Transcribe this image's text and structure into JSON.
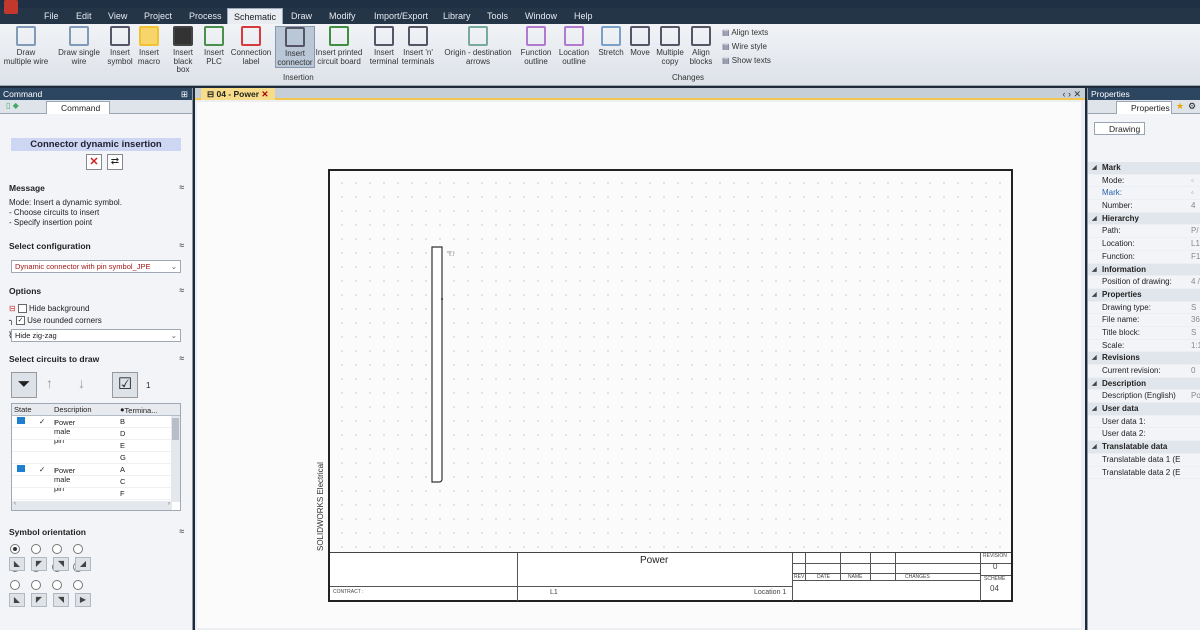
{
  "menu": [
    "File",
    "Edit",
    "View",
    "Project",
    "Process",
    "Schematic",
    "Draw",
    "Modify",
    "Import/Export",
    "Library",
    "Tools",
    "Window",
    "Help"
  ],
  "menu_active": "Schematic",
  "ribbon": {
    "buttons": [
      {
        "label": "Draw multiple wire",
        "icon": "multiple-wire-icon"
      },
      {
        "label": "Draw single wire",
        "icon": "single-wire-icon"
      },
      {
        "label": "Insert symbol",
        "icon": "symbol-icon"
      },
      {
        "label": "Insert macro",
        "icon": "macro-star-icon"
      },
      {
        "label": "Insert black box",
        "icon": "black-box-icon"
      },
      {
        "label": "Insert PLC",
        "icon": "plc-icon"
      },
      {
        "label": "Connection label",
        "icon": "connection-label-icon"
      },
      {
        "label": "Insert connector",
        "icon": "connector-icon"
      },
      {
        "label": "Insert printed circuit board",
        "icon": "pcb-icon"
      },
      {
        "label": "Insert terminal",
        "icon": "terminal-icon"
      },
      {
        "label": "Insert 'n' terminals",
        "icon": "n-terminals-icon"
      },
      {
        "label": "Origin - destination arrows",
        "icon": "origin-destination-icon"
      },
      {
        "label": "Function outline",
        "icon": "function-outline-icon"
      },
      {
        "label": "Location outline",
        "icon": "location-outline-icon"
      },
      {
        "label": "Stretch",
        "icon": "stretch-icon"
      },
      {
        "label": "Move",
        "icon": "move-icon"
      },
      {
        "label": "Multiple copy",
        "icon": "multiple-copy-icon"
      },
      {
        "label": "Align blocks",
        "icon": "align-blocks-icon"
      }
    ],
    "small": [
      "Align texts",
      "Wire style",
      "Show texts"
    ],
    "groups": [
      "Insertion",
      "Changes"
    ]
  },
  "left_panel": {
    "header": "Command",
    "tab": "Command",
    "title": "Connector dynamic insertion",
    "message_heading": "Message",
    "message_lines": [
      "Mode: Insert a dynamic symbol.",
      "- Choose circuits to insert",
      "- Specify insertion point"
    ],
    "config_heading": "Select configuration",
    "config_value": "Dynamic connector with pin symbol_JPE",
    "options_heading": "Options",
    "opt_hide_bg": "Hide background",
    "opt_rounded": "Use rounded corners",
    "zigzag_value": "Hide zig-zag",
    "circuits_heading": "Select circuits to draw",
    "circuits_count": "1",
    "table_headers": [
      "State",
      "",
      "Description",
      "Termina..."
    ],
    "rows": [
      {
        "desc": "Power male pin",
        "term": "B"
      },
      {
        "desc": "",
        "term": "D"
      },
      {
        "desc": "",
        "term": "E"
      },
      {
        "desc": "",
        "term": "G"
      },
      {
        "desc": "Power male pin",
        "term": "A"
      },
      {
        "desc": "",
        "term": "C"
      },
      {
        "desc": "",
        "term": "F"
      }
    ],
    "orientation_heading": "Symbol orientation"
  },
  "document": {
    "tab": "04 - Power",
    "sheet_title": "Power",
    "side_text": "SOLIDWORKS Electrical",
    "revision_label": "REVISION",
    "revision_value": "0",
    "scheme_label": "SCHEME",
    "scheme_value": "04",
    "function_value": "L1",
    "location_value": "Location 1",
    "contract_label": "CONTRACT :",
    "changes_label": "CHANGES",
    "date_label": "DATE",
    "name_label": "NAME",
    "rev_labels": [
      "REV",
      "DATE",
      "NAME"
    ]
  },
  "right_panel": {
    "header": "Properties",
    "tab": "Properties",
    "subtab": "Drawing",
    "rows": [
      {
        "type": "cat",
        "label": "Mark"
      },
      {
        "type": "item",
        "label": "Mode:",
        "value": "◦"
      },
      {
        "type": "item",
        "label": "Mark:",
        "value": "◦",
        "blue": true
      },
      {
        "type": "item",
        "label": "Number:",
        "value": "4"
      },
      {
        "type": "cat",
        "label": "Hierarchy"
      },
      {
        "type": "item",
        "label": "Path:",
        "value": "P/"
      },
      {
        "type": "item",
        "label": "Location:",
        "value": "L1"
      },
      {
        "type": "item",
        "label": "Function:",
        "value": "F1"
      },
      {
        "type": "cat",
        "label": "Information"
      },
      {
        "type": "item",
        "label": "Position of drawing:",
        "value": "4 /"
      },
      {
        "type": "cat",
        "label": "Properties"
      },
      {
        "type": "item",
        "label": "Drawing type:",
        "value": "S"
      },
      {
        "type": "item",
        "label": "File name:",
        "value": "36"
      },
      {
        "type": "item",
        "label": "Title block:",
        "value": "S"
      },
      {
        "type": "item",
        "label": "Scale:",
        "value": "1:1"
      },
      {
        "type": "cat",
        "label": "Revisions"
      },
      {
        "type": "item",
        "label": "Current revision:",
        "value": "0"
      },
      {
        "type": "cat",
        "label": "Description"
      },
      {
        "type": "item",
        "label": "Description (English)",
        "value": "Po"
      },
      {
        "type": "cat",
        "label": "User data"
      },
      {
        "type": "item",
        "label": "User data 1:",
        "value": ""
      },
      {
        "type": "item",
        "label": "User data 2:",
        "value": ""
      },
      {
        "type": "cat",
        "label": "Translatable data"
      },
      {
        "type": "item",
        "label": "Translatable data 1 (E",
        "value": ""
      },
      {
        "type": "item",
        "label": "Translatable data 2 (E",
        "value": ""
      }
    ]
  }
}
